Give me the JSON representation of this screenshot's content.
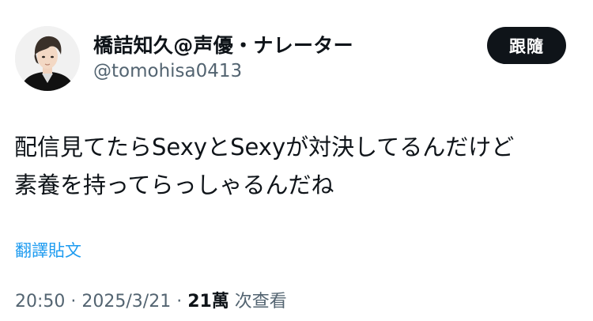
{
  "author": {
    "display_name": "橋詰知久@声優・ナレーター",
    "handle": "@tomohisa0413"
  },
  "follow_button": {
    "label": "跟隨"
  },
  "tweet": {
    "lines": [
      "配信見てたらSexyとSexyが対決してるんだけど",
      "素養を持ってらっしゃるんだね"
    ]
  },
  "translate_link": {
    "label": "翻譯貼文"
  },
  "meta": {
    "time": "20:50",
    "separator1": " · ",
    "date": "2025/3/21",
    "separator2": " · ",
    "views_count": "21萬",
    "views_label": " 次查看"
  }
}
